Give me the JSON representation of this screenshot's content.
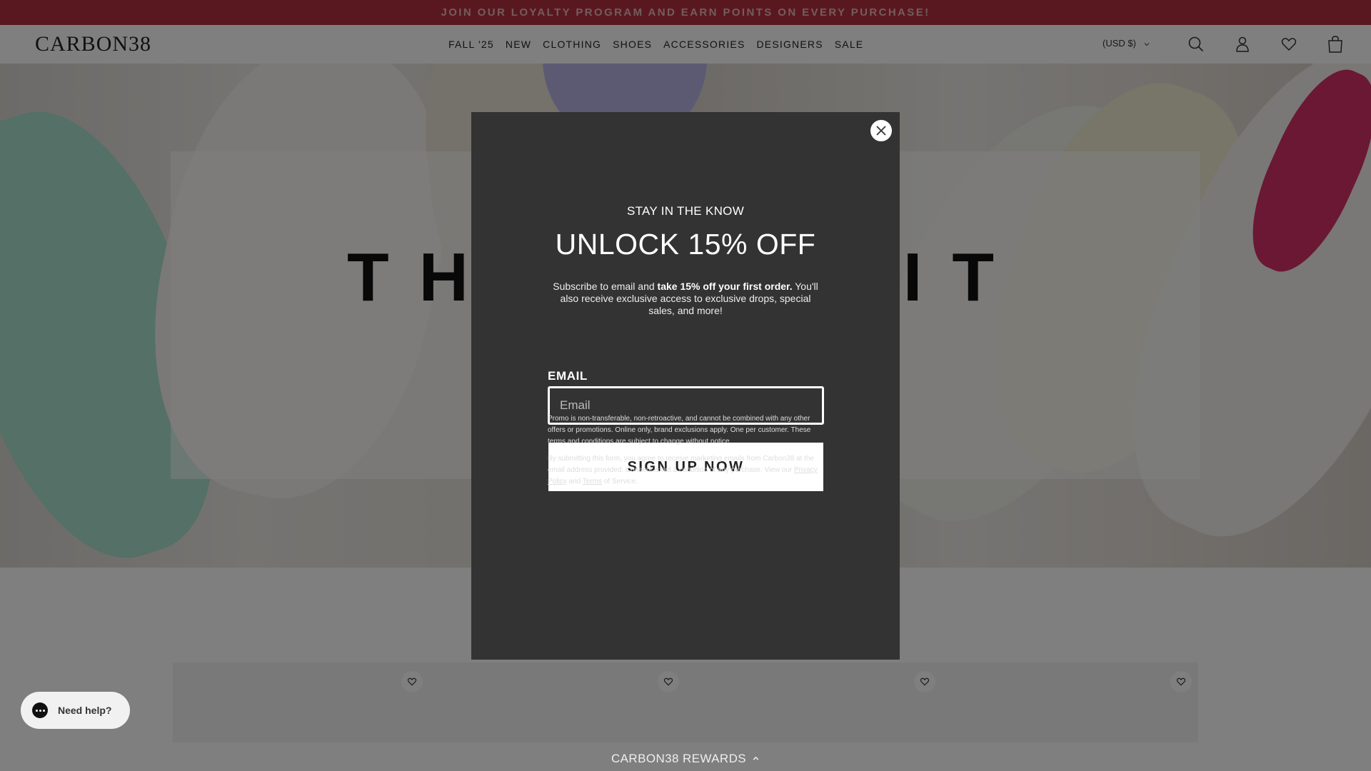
{
  "announcement": "JOIN OUR LOYALTY PROGRAM AND EARN POINTS ON EVERY PURCHASE!",
  "header": {
    "logo": "CARBON38",
    "nav": [
      "FALL '25",
      "NEW",
      "CLOTHING",
      "SHOES",
      "ACCESSORIES",
      "DESIGNERS",
      "SALE"
    ],
    "currency": "(USD $)",
    "icons": [
      "search-icon",
      "account-icon",
      "wishlist-icon",
      "cart-icon"
    ]
  },
  "hero": {
    "title": "THE S EDIT"
  },
  "modal": {
    "kicker": "STAY IN THE KNOW",
    "headline": "UNLOCK 15% OFF",
    "desc_before": "Subscribe to email and ",
    "desc_bold": "take 15% off your first order.",
    "desc_after": " You'll also receive exclusive access to exclusive drops, special sales, and more!",
    "email_label": "EMAIL",
    "email_placeholder": "Email",
    "email_value": "",
    "button": "SIGN UP NOW",
    "fine_print_1": "Promo is non-transferable, non-retroactive, and cannot be combined with any other offers or promotions. Online only, brand exclusions apply. One per customer. These terms and conditions are subject to change without notice.",
    "fine_print_2_before": "By submitting this form, you agree to receive marketing emails from Carbon38 at the email address provided. Consent is not a condition of any purchase. View our ",
    "privacy_link": "Privacy Policy",
    "and_text": " and ",
    "terms_link": "Terms",
    "fine_print_2_after": " of Service."
  },
  "chat": {
    "label": "Need help?"
  },
  "rewards": {
    "label": "CARBON38 REWARDS"
  },
  "colors": {
    "promo_bar": "#b3313e",
    "modal_bg": "#333333"
  }
}
